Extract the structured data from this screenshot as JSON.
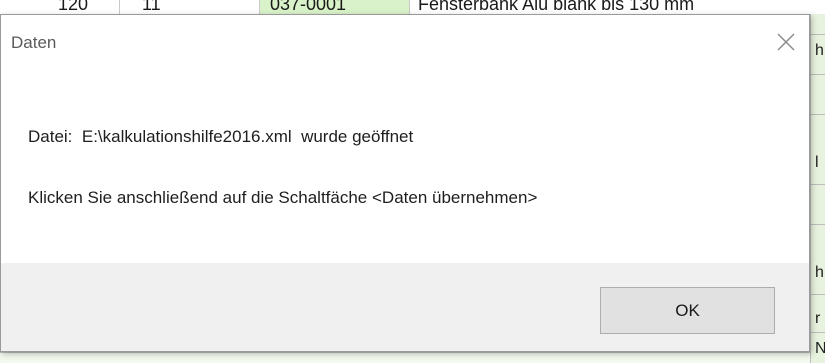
{
  "background": {
    "top_cells": [
      "120",
      "11",
      "037-0001",
      "Fensterbank Alu blank bis 130 mm"
    ],
    "right_glyphs": [
      "h",
      "l",
      "h",
      "r",
      "N"
    ]
  },
  "dialog": {
    "title": "Daten",
    "close_icon": "close-icon",
    "message_line1": "Datei:  E:\\kalkulationshilfe2016.xml  wurde geöffnet",
    "message_line2": "Klicken Sie anschließend auf die Schaltfäche <Daten übernehmen>",
    "ok_label": "OK"
  },
  "colors": {
    "footer_bg": "#f0f0f0",
    "button_bg": "#e1e1e1",
    "sheet_green": "#d9f2c9"
  }
}
